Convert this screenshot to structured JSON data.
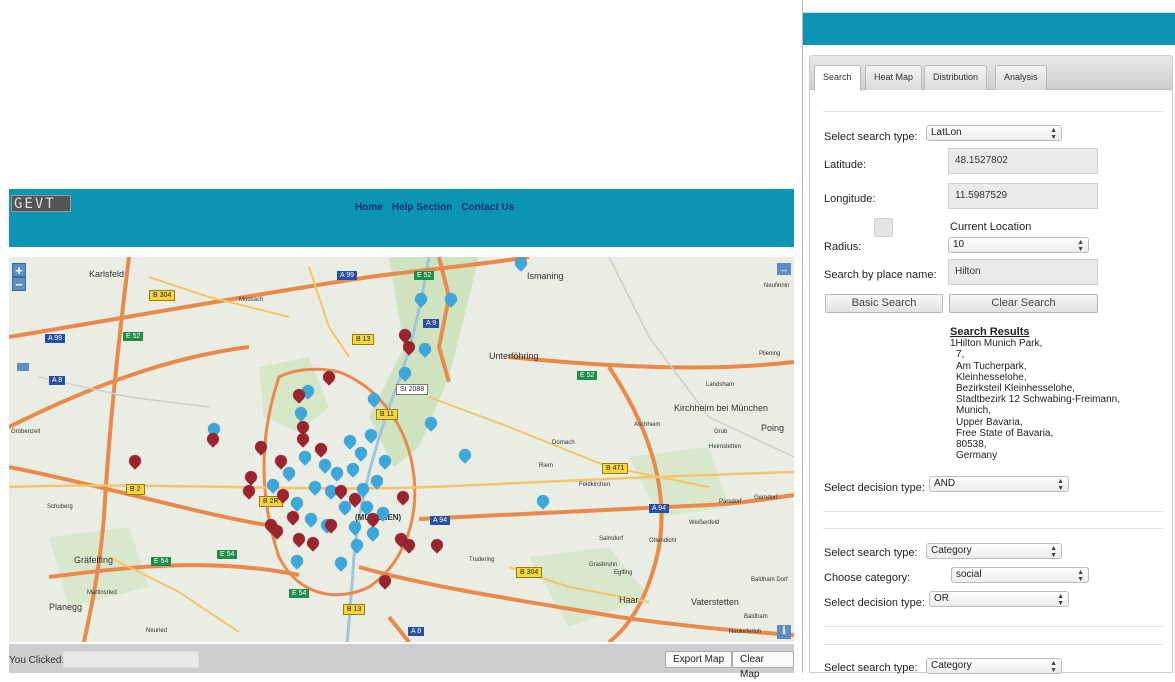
{
  "app": {
    "logo_text": "GEVT",
    "nav": [
      "Home",
      "Help Section",
      "Contact Us"
    ]
  },
  "map": {
    "zoom_in": "+",
    "zoom_out": "−",
    "info": "i",
    "expand": "↔",
    "places": [
      "Karlsfeld",
      "Ismaning",
      "Unterföhring",
      "Kirchheim bei München",
      "Poing",
      "Gräfelfing",
      "Planegg",
      "Haar",
      "Vaterstetten",
      "Neufinnin",
      "Landsham",
      "Aschheim",
      "Dornach",
      "Feldkirchen",
      "Parsdorf",
      "Weißenfeld",
      "Salmdorf",
      "Ottendichl",
      "Grasbrunn",
      "Baldham",
      "Neukeferloh",
      "Gröbenzell",
      "Schuberg",
      "Martinsried",
      "Neuried",
      "Pliening",
      "Heimstetten",
      "Gerndorf",
      "Eglfing",
      "Baldham Dorf",
      "Moosach",
      "Riem",
      "Grub",
      "Trudering"
    ],
    "shields": {
      "yellow": [
        "B 304",
        "B 13",
        "B 11",
        "B 2",
        "B 471",
        "B 2R",
        "B 304",
        "B 13"
      ],
      "blue": [
        "A 99",
        "A 9",
        "A 99",
        "A 8",
        "A 94",
        "A 94",
        "A 8"
      ],
      "green": [
        "E 52",
        "E 52",
        "E 52",
        "E 54",
        "E 54",
        "E 54"
      ],
      "white": [
        "St 2088"
      ]
    },
    "center_label": "(MÜNCHEN)",
    "marker_colors": {
      "blue": "#3aa8dc",
      "red": "#9c2430"
    }
  },
  "bottom": {
    "clicked_label": "You Clicked:",
    "clicked_value": "",
    "export_btn": "Export Map",
    "clear_btn": "Clear Map"
  },
  "panel": {
    "tabs": [
      "Search",
      "Heat Map",
      "Distribution",
      "Analysis"
    ],
    "search1": {
      "type_label": "Select search type:",
      "type_value": "LatLon",
      "lat_label": "Latitude:",
      "lat_value": "48.1527802",
      "lon_label": "Longitude:",
      "lon_value": "11.5987529",
      "current_location_label": "Current Location",
      "radius_label": "Radius:",
      "radius_value": "10",
      "place_label": "Search by place name:",
      "place_value": "Hilton",
      "basic_search_btn": "Basic Search",
      "clear_search_btn": "Clear Search",
      "results_title": "Search Results",
      "results_lines": [
        "1Hilton Munich Park,",
        "  7,",
        "  Am Tucherpark,",
        "  Kleinhesselohe,",
        "  Bezirksteil Kleinhesselohe,",
        "  Stadtbezirk 12 Schwabing-Freimann,",
        "  Munich,",
        "  Upper Bavaria,",
        "  Free State of Bavaria,",
        "  80538,",
        "  Germany"
      ],
      "decision_label": "Select decision type:",
      "decision_value": "AND"
    },
    "search2": {
      "type_label": "Select search type:",
      "type_value": "Category",
      "category_label": "Choose category:",
      "category_value": "social",
      "decision_label": "Select decision type:",
      "decision_value": "OR"
    },
    "search3": {
      "type_label": "Select search type:",
      "type_value": "Category"
    }
  }
}
